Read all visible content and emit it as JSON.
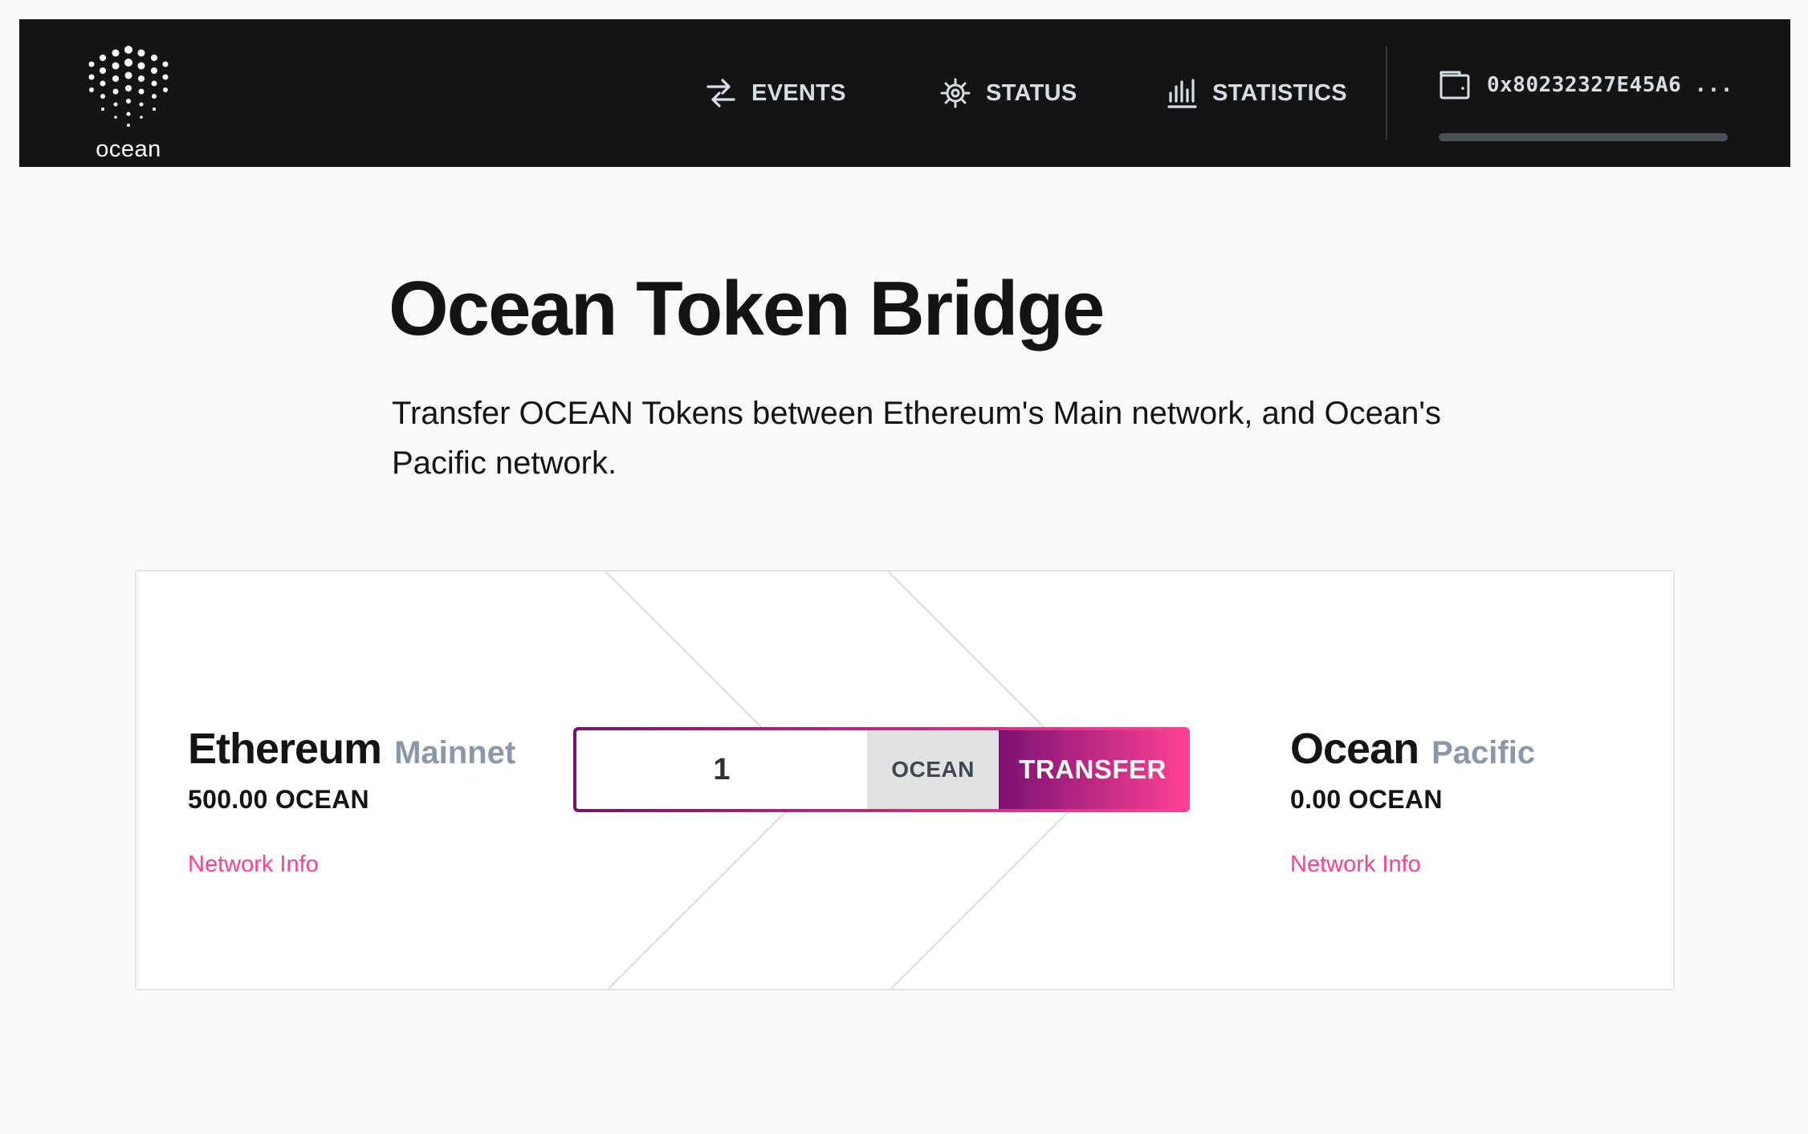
{
  "header": {
    "logo_text": "ocean",
    "nav": {
      "events": "EVENTS",
      "status": "STATUS",
      "statistics": "STATISTICS"
    },
    "wallet_address": "0x80232327E45A6 ..."
  },
  "hero": {
    "title": "Ocean Token Bridge",
    "subtitle": "Transfer OCEAN Tokens between Ethereum's Main network, and Ocean's Pacific network."
  },
  "bridge": {
    "from": {
      "name": "Ethereum",
      "network": "Mainnet",
      "balance": "500.00 OCEAN",
      "link": "Network Info"
    },
    "to": {
      "name": "Ocean",
      "network": "Pacific",
      "balance": "0.00 OCEAN",
      "link": "Network Info"
    },
    "amount_value": "1",
    "token": "OCEAN",
    "transfer_label": "TRANSFER"
  },
  "colors": {
    "header_bg": "#141414",
    "accent_pink": "#ff4092",
    "accent_purple": "#7b1173",
    "network_grey": "#8b98a9"
  },
  "icons": {
    "events": "swap-arrows-icon",
    "status": "gear-icon",
    "statistics": "bar-chart-icon",
    "wallet": "wallet-icon"
  }
}
